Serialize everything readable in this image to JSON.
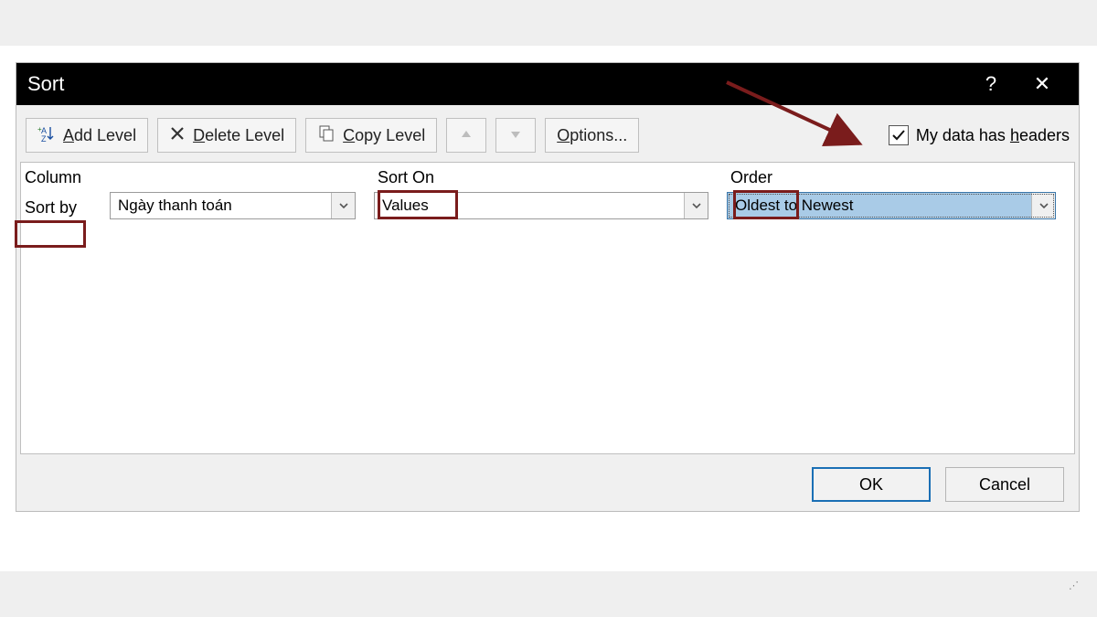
{
  "dialog": {
    "title": "Sort",
    "help_symbol": "?",
    "close_symbol": "✕"
  },
  "toolbar": {
    "add_level": "Add Level",
    "delete_level": "Delete Level",
    "copy_level": "Copy Level",
    "options": "Options...",
    "headers_label": "My data has headers",
    "headers_checked": true
  },
  "headers": {
    "column": "Column",
    "sort_on": "Sort On",
    "order": "Order"
  },
  "row": {
    "label": "Sort by",
    "column_value": "Ngày thanh toán",
    "sort_on_value": "Values",
    "order_value": "Oldest to Newest"
  },
  "footer": {
    "ok": "OK",
    "cancel": "Cancel"
  },
  "colors": {
    "highlight": "#7a1c1c",
    "selection": "#a9cbe7"
  }
}
